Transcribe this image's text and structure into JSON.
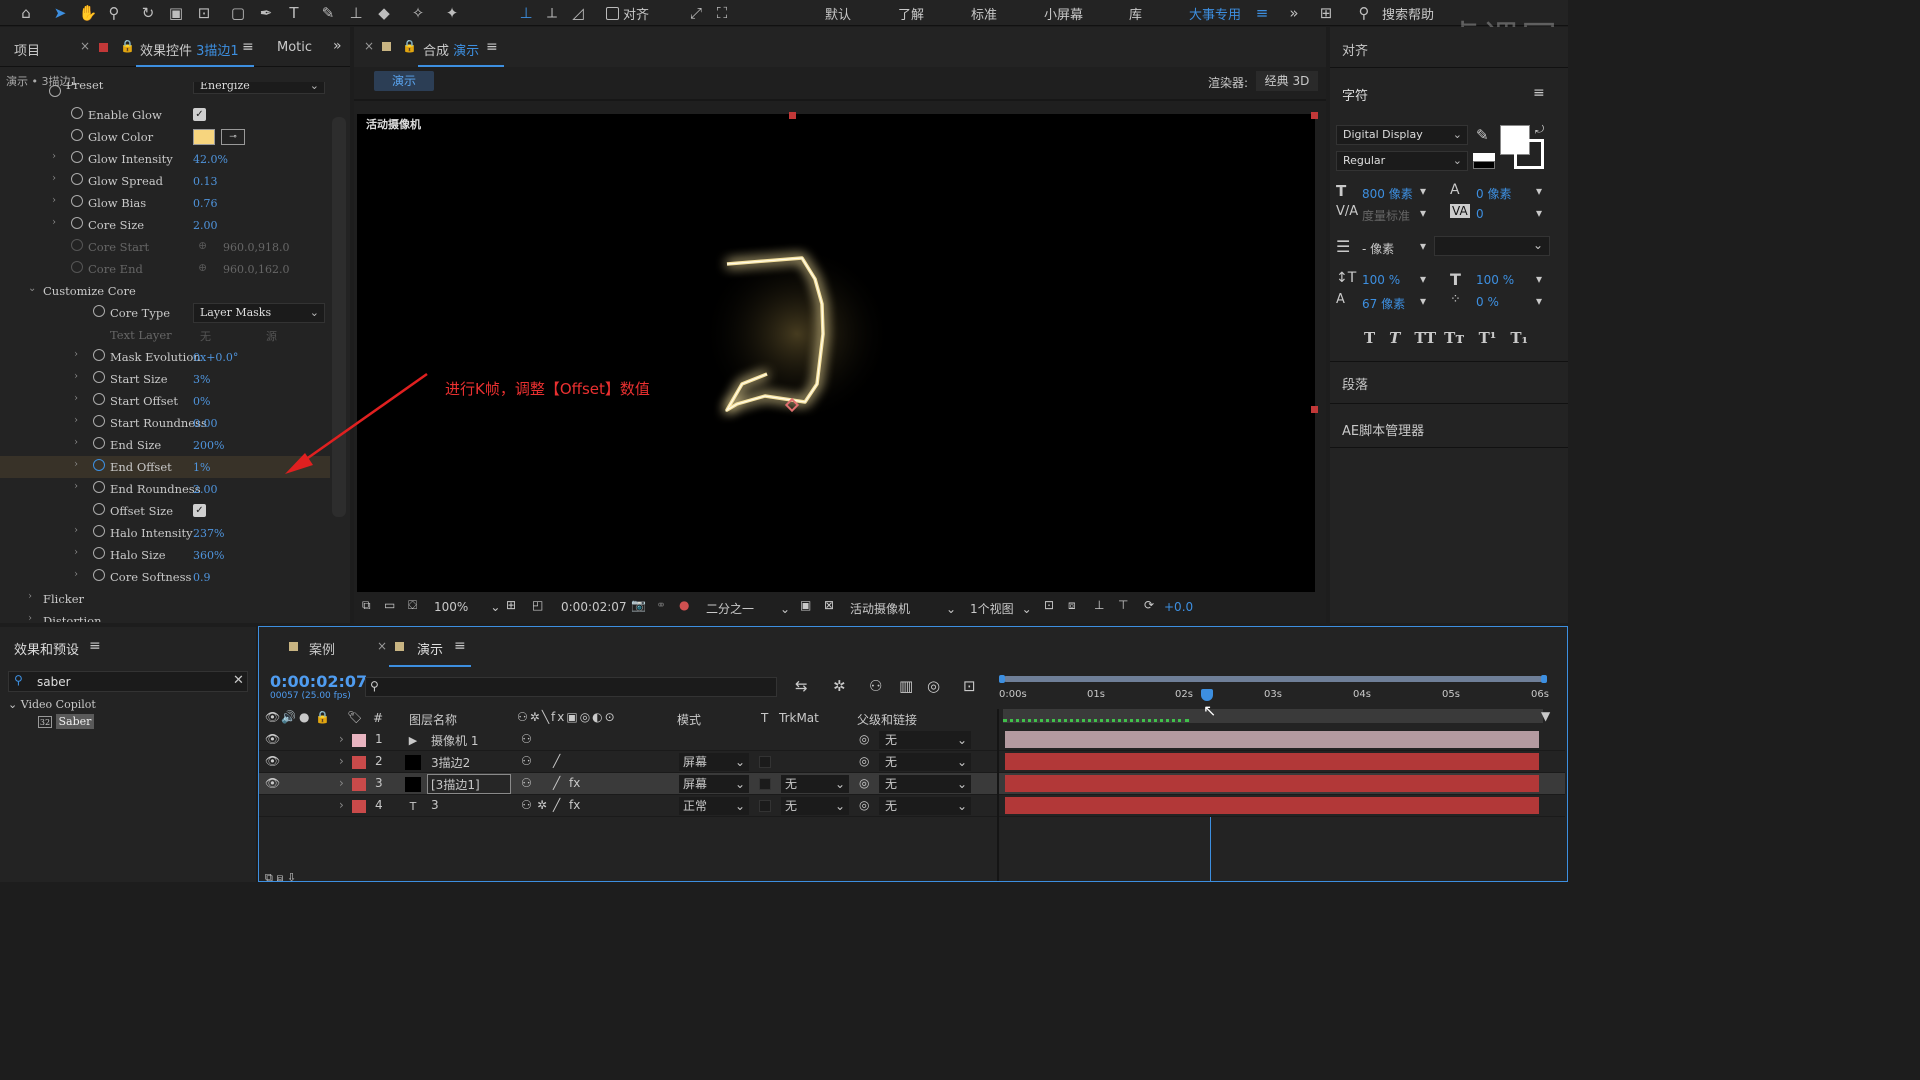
{
  "toolbar": {
    "align_label": "对齐",
    "workspaces": [
      "默认",
      "了解",
      "标准",
      "小屏幕",
      "库",
      "大事专用"
    ],
    "active_workspace": "大事专用",
    "search_help": "搜索帮助",
    "watermark": "虎课网"
  },
  "left_panel": {
    "tab_project": "项目",
    "tab_effect_controls_prefix": "效果控件",
    "tab_effect_controls_layer": "3描边1",
    "tab_motion": "Motic",
    "breadcrumb": "演示 • 3描边1",
    "preset_label": "Preset",
    "preset_value": "Energize",
    "rows": [
      {
        "label": "Enable Glow",
        "type": "check",
        "indent": 1
      },
      {
        "label": "Glow Color",
        "type": "color",
        "indent": 1
      },
      {
        "label": "Glow Intensity",
        "value": "42.0%",
        "indent": 1,
        "twirl": true
      },
      {
        "label": "Glow Spread",
        "value": "0.13",
        "indent": 1,
        "twirl": true
      },
      {
        "label": "Glow Bias",
        "value": "0.76",
        "indent": 1,
        "twirl": true
      },
      {
        "label": "Core Size",
        "value": "2.00",
        "indent": 1,
        "twirl": true
      },
      {
        "label": "Core Start",
        "value": "960.0,918.0",
        "indent": 1,
        "dim": true,
        "point": true
      },
      {
        "label": "Core End",
        "value": "960.0,162.0",
        "indent": 1,
        "dim": true,
        "point": true
      },
      {
        "label": "Customize Core",
        "type": "group",
        "indent": 0,
        "open": true
      },
      {
        "label": "Core Type",
        "type": "dropdown",
        "value": "Layer Masks",
        "indent": 2
      },
      {
        "label": "Text Layer",
        "type": "dimdrop",
        "value": "无",
        "value2": "源",
        "indent": 2
      },
      {
        "label": "Mask Evolution",
        "value": "0x+0.0°",
        "indent": 2,
        "twirl": true
      },
      {
        "label": "Start Size",
        "value": "3%",
        "indent": 2,
        "twirl": true
      },
      {
        "label": "Start Offset",
        "value": "0%",
        "indent": 2,
        "twirl": true
      },
      {
        "label": "Start Roundness",
        "value": "0.00",
        "indent": 2,
        "twirl": true
      },
      {
        "label": "End Size",
        "value": "200%",
        "indent": 2,
        "twirl": true
      },
      {
        "label": "End Offset",
        "value": "1%",
        "indent": 2,
        "twirl": true,
        "highlight": true
      },
      {
        "label": "End Roundness",
        "value": "2.00",
        "indent": 2,
        "twirl": true
      },
      {
        "label": "Offset Size",
        "type": "check",
        "indent": 2
      },
      {
        "label": "Halo Intensity",
        "value": "237%",
        "indent": 2,
        "twirl": true
      },
      {
        "label": "Halo Size",
        "value": "360%",
        "indent": 2,
        "twirl": true
      },
      {
        "label": "Core Softness",
        "value": "0.9",
        "indent": 2,
        "twirl": true
      },
      {
        "label": "Flicker",
        "type": "group",
        "indent": 0
      },
      {
        "label": "Distortion",
        "type": "group",
        "indent": 0
      }
    ]
  },
  "composition": {
    "tab_prefix": "合成",
    "tab_name": "演示",
    "sub_tab": "演示",
    "renderer_label": "渲染器:",
    "renderer_value": "经典 3D",
    "camera_label": "活动摄像机",
    "annotation": "进行K帧，调整【Offset】数值",
    "zoom": "100%",
    "timecode": "0:00:02:07",
    "resolution": "二分之一",
    "view_camera": "活动摄像机",
    "views": "1个视图",
    "exposure": "+0.0"
  },
  "right_panel": {
    "align_title": "对齐",
    "char_title": "字符",
    "font": "Digital Display",
    "style": "Regular",
    "font_size": "800 像素",
    "leading": "0 像素",
    "kerning": "度量标准",
    "tracking": "0",
    "stroke": "- 像素",
    "vscale": "100 %",
    "hscale": "100 %",
    "baseline": "67 像素",
    "tsume": "0 %",
    "paragraph_title": "段落",
    "script_title": "AE脚本管理器"
  },
  "effects_presets": {
    "title": "效果和预设",
    "search_value": "saber",
    "category": "Video Copilot",
    "item": "Saber"
  },
  "timeline": {
    "tab_case": "案例",
    "tab_demo": "演示",
    "timecode": "0:00:02:07",
    "frame_info": "00057 (25.00 fps)",
    "col_num": "#",
    "col_name": "图层名称",
    "col_mode": "模式",
    "col_t": "T",
    "col_trkmat": "TrkMat",
    "col_parent": "父级和链接",
    "ruler": [
      "0:00s",
      "01s",
      "02s",
      "03s",
      "04s",
      "05s",
      "06s"
    ],
    "layers": [
      {
        "num": "1",
        "name": "摄像机 1",
        "color": "#e8b4c0",
        "mode": "",
        "trkmat": "",
        "parent": "无",
        "type": "camera"
      },
      {
        "num": "2",
        "name": "3描边2",
        "color": "#c94a4a",
        "mode": "屏幕",
        "trkmat": "",
        "parent": "无",
        "type": "solid"
      },
      {
        "num": "3",
        "name": "[3描边1]",
        "color": "#c94a4a",
        "mode": "屏幕",
        "trkmat": "无",
        "parent": "无",
        "type": "solid",
        "selected": true
      },
      {
        "num": "4",
        "name": "3",
        "color": "#c94a4a",
        "mode": "正常",
        "trkmat": "无",
        "parent": "无",
        "type": "text"
      }
    ]
  }
}
